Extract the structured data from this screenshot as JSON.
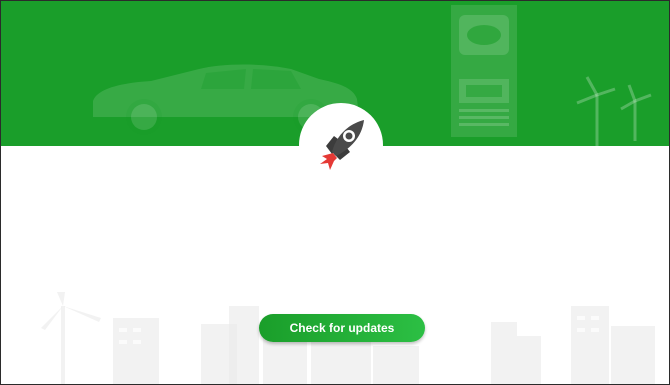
{
  "colors": {
    "banner_green": "#1a9e2a",
    "button_green_start": "#1a9e2a",
    "button_green_end": "#2cbf44",
    "rocket_body": "#4a4a4a",
    "rocket_flame": "#e53935"
  },
  "icons": {
    "hero": "rocket-icon",
    "banner_left": "car-illustration",
    "banner_middle": "charging-station-illustration",
    "banner_right": "wind-turbine-illustration",
    "footer": "city-skyline-illustration"
  },
  "actions": {
    "check_updates_label": "Check for updates"
  }
}
